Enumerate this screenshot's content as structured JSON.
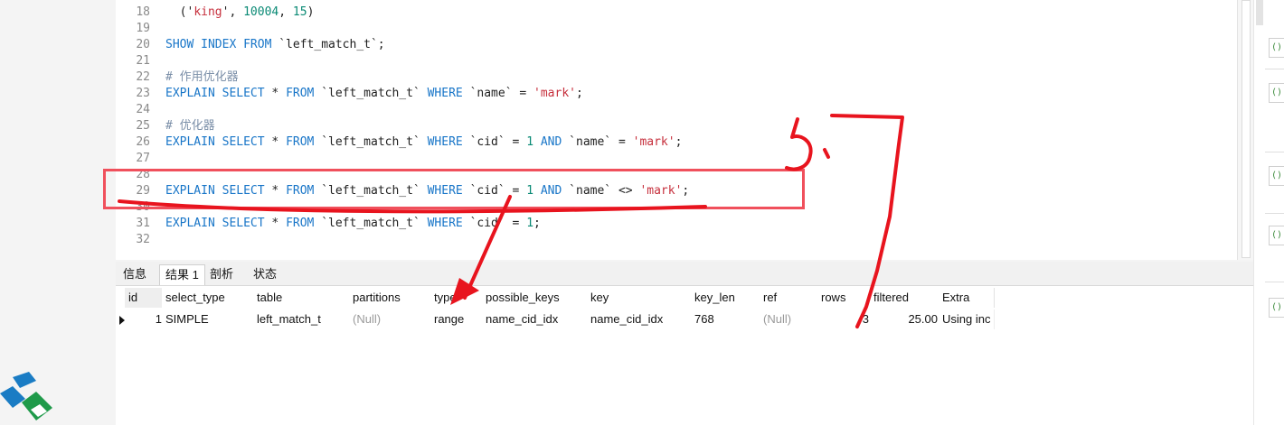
{
  "editor": {
    "lines": [
      {
        "n": "18",
        "tokens": [
          {
            "t": "  ('",
            "c": ""
          },
          {
            "t": "king",
            "c": "str"
          },
          {
            "t": "', ",
            "c": ""
          },
          {
            "t": "10004",
            "c": "num"
          },
          {
            "t": ", ",
            "c": ""
          },
          {
            "t": "15",
            "c": "num"
          },
          {
            "t": ")",
            "c": ""
          }
        ]
      },
      {
        "n": "19",
        "tokens": []
      },
      {
        "n": "20",
        "tokens": [
          {
            "t": "SHOW INDEX FROM",
            "c": "kw"
          },
          {
            "t": " `left_match_t`;",
            "c": ""
          }
        ]
      },
      {
        "n": "21",
        "tokens": []
      },
      {
        "n": "22",
        "tokens": [
          {
            "t": "# 作用优化器",
            "c": "cmt"
          }
        ]
      },
      {
        "n": "23",
        "tokens": [
          {
            "t": "EXPLAIN SELECT",
            "c": "kw"
          },
          {
            "t": " * ",
            "c": ""
          },
          {
            "t": "FROM",
            "c": "kw"
          },
          {
            "t": " `left_match_t` ",
            "c": ""
          },
          {
            "t": "WHERE",
            "c": "kw"
          },
          {
            "t": " `name` = ",
            "c": ""
          },
          {
            "t": "'mark'",
            "c": "str"
          },
          {
            "t": ";",
            "c": ""
          }
        ]
      },
      {
        "n": "24",
        "tokens": []
      },
      {
        "n": "25",
        "tokens": [
          {
            "t": "# 优化器",
            "c": "cmt"
          }
        ]
      },
      {
        "n": "26",
        "tokens": [
          {
            "t": "EXPLAIN SELECT",
            "c": "kw"
          },
          {
            "t": " * ",
            "c": ""
          },
          {
            "t": "FROM",
            "c": "kw"
          },
          {
            "t": " `left_match_t` ",
            "c": ""
          },
          {
            "t": "WHERE",
            "c": "kw"
          },
          {
            "t": " `cid` = ",
            "c": ""
          },
          {
            "t": "1",
            "c": "num"
          },
          {
            "t": " ",
            "c": ""
          },
          {
            "t": "AND",
            "c": "kw"
          },
          {
            "t": " `name` = ",
            "c": ""
          },
          {
            "t": "'mark'",
            "c": "str"
          },
          {
            "t": ";",
            "c": ""
          }
        ]
      },
      {
        "n": "27",
        "tokens": []
      },
      {
        "n": "28",
        "tokens": []
      },
      {
        "n": "29",
        "tokens": [
          {
            "t": "EXPLAIN SELECT",
            "c": "kw"
          },
          {
            "t": " * ",
            "c": ""
          },
          {
            "t": "FROM",
            "c": "kw"
          },
          {
            "t": " `left_match_t` ",
            "c": ""
          },
          {
            "t": "WHERE",
            "c": "kw"
          },
          {
            "t": " `cid` = ",
            "c": ""
          },
          {
            "t": "1",
            "c": "num"
          },
          {
            "t": " ",
            "c": ""
          },
          {
            "t": "AND",
            "c": "kw"
          },
          {
            "t": " `name` <> ",
            "c": ""
          },
          {
            "t": "'mark'",
            "c": "str"
          },
          {
            "t": ";",
            "c": ""
          }
        ]
      },
      {
        "n": "30",
        "tokens": []
      },
      {
        "n": "31",
        "tokens": [
          {
            "t": "EXPLAIN SELECT",
            "c": "kw"
          },
          {
            "t": " * ",
            "c": ""
          },
          {
            "t": "FROM",
            "c": "kw"
          },
          {
            "t": " `left_match_t` ",
            "c": ""
          },
          {
            "t": "WHERE",
            "c": "kw"
          },
          {
            "t": " `cid` = ",
            "c": ""
          },
          {
            "t": "1",
            "c": "num"
          },
          {
            "t": ";",
            "c": ""
          }
        ]
      },
      {
        "n": "32",
        "tokens": []
      }
    ]
  },
  "tabs": [
    {
      "label": "信息",
      "active": false
    },
    {
      "label": "结果 1",
      "active": true
    },
    {
      "label": "剖析",
      "active": false
    },
    {
      "label": "状态",
      "active": false
    }
  ],
  "results": {
    "columns": [
      "id",
      "select_type",
      "table",
      "partitions",
      "type",
      "possible_keys",
      "key",
      "key_len",
      "ref",
      "rows",
      "filtered",
      "Extra"
    ],
    "rows": [
      [
        "1",
        "SIMPLE",
        "left_match_t",
        "(Null)",
        "range",
        "name_cid_idx",
        "name_cid_idx",
        "768",
        "(Null)",
        "3",
        "25.00",
        "Using inc"
      ]
    ]
  },
  "annotation": {
    "color": "#e8141e",
    "handwritten_text": "5.7"
  },
  "right_panel": {
    "icon": "sql-file-icon",
    "icon_glyph": "()"
  },
  "colors": {
    "keyword": "#1976c8",
    "string": "#c62f3c",
    "number": "#0a8a75",
    "comment": "#7b8fa8",
    "highlight_box": "#f0505c"
  }
}
